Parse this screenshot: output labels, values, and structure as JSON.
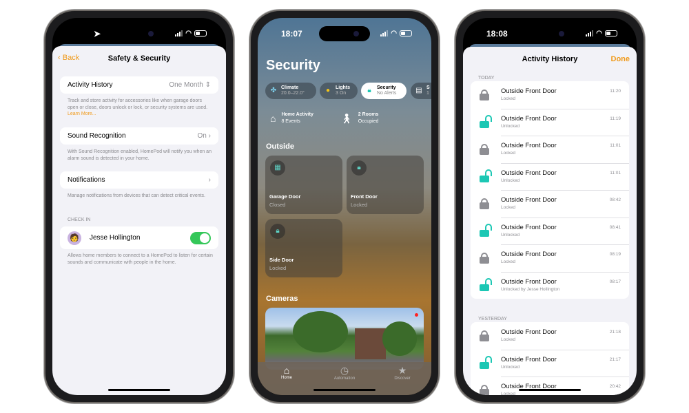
{
  "phone1": {
    "status": {
      "location_icon": "location-arrow-icon"
    },
    "nav": {
      "back_label": "Back",
      "title": "Safety & Security"
    },
    "activity_history": {
      "label": "Activity History",
      "value": "One Month",
      "description": "Track and store activity for accessories like when garage doors open or close, doors unlock or lock, or security systems are used.",
      "learn_more": "Learn More..."
    },
    "sound_recognition": {
      "label": "Sound Recognition",
      "value": "On",
      "description": "With Sound Recognition enabled, HomePod will notify you when an alarm sound is detected in your home."
    },
    "notifications": {
      "label": "Notifications",
      "description": "Manage notifications from devices that can detect critical events."
    },
    "check_in": {
      "header": "CHECK IN",
      "name": "Jesse Hollington",
      "enabled": true,
      "description": "Allows home members to connect to a HomePod to listen for certain sounds and communicate with people in the home."
    }
  },
  "phone2": {
    "status": {
      "time": "18:07"
    },
    "title": "Security",
    "chips": [
      {
        "label": "Climate",
        "sub": "20.0–22.0°",
        "icon": "fan-icon"
      },
      {
        "label": "Lights",
        "sub": "3 On",
        "icon": "lightbulb-icon"
      },
      {
        "label": "Security",
        "sub": "No Alerts",
        "icon": "lock-icon",
        "active": true
      },
      {
        "label": "S",
        "sub": "1",
        "icon": "speaker-icon"
      }
    ],
    "activity": [
      {
        "label": "Home Activity",
        "sub": "8 Events",
        "icon": "house-icon"
      },
      {
        "label": "2 Rooms",
        "sub": "Occupied",
        "icon": "person-walking-icon"
      }
    ],
    "outside_header": "Outside",
    "tiles": [
      {
        "name": "Garage Door",
        "state": "Closed",
        "icon": "garage-icon"
      },
      {
        "name": "Front Door",
        "state": "Locked",
        "icon": "lock-icon"
      },
      {
        "name": "Side Door",
        "state": "Locked",
        "icon": "lock-icon"
      }
    ],
    "cameras_header": "Cameras",
    "tabs": [
      {
        "label": "Home",
        "icon": "house-icon",
        "active": true
      },
      {
        "label": "Automation",
        "icon": "clock-check-icon"
      },
      {
        "label": "Discover",
        "icon": "star-icon"
      }
    ]
  },
  "phone3": {
    "status": {
      "time": "18:08"
    },
    "title": "Activity History",
    "done_label": "Done",
    "sections": [
      {
        "header": "TODAY",
        "items": [
          {
            "name": "Outside Front Door",
            "state": "Locked",
            "time": "11:20",
            "locked": true
          },
          {
            "name": "Outside Front Door",
            "state": "Unlocked",
            "time": "11:19",
            "locked": false
          },
          {
            "name": "Outside Front Door",
            "state": "Locked",
            "time": "11:01",
            "locked": true
          },
          {
            "name": "Outside Front Door",
            "state": "Unlocked",
            "time": "11:01",
            "locked": false
          },
          {
            "name": "Outside Front Door",
            "state": "Locked",
            "time": "08:42",
            "locked": true
          },
          {
            "name": "Outside Front Door",
            "state": "Unlocked",
            "time": "08:41",
            "locked": false
          },
          {
            "name": "Outside Front Door",
            "state": "Locked",
            "time": "08:19",
            "locked": true
          },
          {
            "name": "Outside Front Door",
            "state": "Unlocked by Jesse Hollington",
            "time": "08:17",
            "locked": false
          }
        ]
      },
      {
        "header": "YESTERDAY",
        "items": [
          {
            "name": "Outside Front Door",
            "state": "Locked",
            "time": "21:18",
            "locked": true
          },
          {
            "name": "Outside Front Door",
            "state": "Unlocked",
            "time": "21:17",
            "locked": false
          },
          {
            "name": "Outside Front Door",
            "state": "Locked",
            "time": "20:42",
            "locked": true
          }
        ]
      }
    ]
  },
  "colors": {
    "accent": "#f09a1a",
    "toggle_on": "#34c759",
    "unlocked": "#1cc7b4",
    "locked": "#8e8e93"
  }
}
